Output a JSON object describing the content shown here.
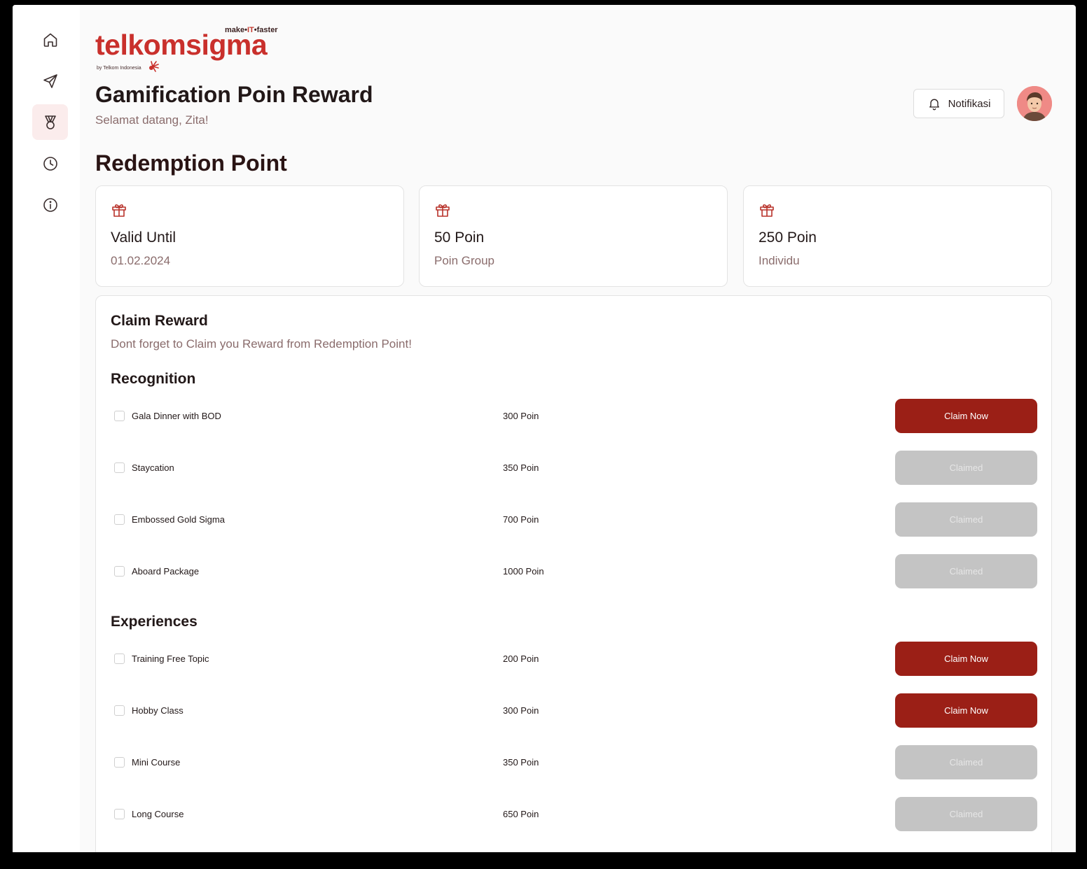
{
  "brand": {
    "tagline_pre": "make•",
    "tagline_it": "IT",
    "tagline_post": "•faster",
    "wordmark": "telkomsigma",
    "byline": "by Telkom Indonesia",
    "color": "#c9302c"
  },
  "sidebar": {
    "items": [
      {
        "icon": "home-icon",
        "active": false
      },
      {
        "icon": "send-icon",
        "active": false
      },
      {
        "icon": "medal-icon",
        "active": true
      },
      {
        "icon": "clock-icon",
        "active": false
      },
      {
        "icon": "info-icon",
        "active": false
      }
    ]
  },
  "header": {
    "title": "Gamification Poin Reward",
    "welcome": "Selamat datang, Zita!",
    "notif_label": "Notifikasi"
  },
  "redemption": {
    "title": "Redemption Point",
    "cards": [
      {
        "title": "Valid Until",
        "sub": "01.02.2024"
      },
      {
        "title": "50 Poin",
        "sub": "Poin Group"
      },
      {
        "title": "250 Poin",
        "sub": "Individu"
      }
    ]
  },
  "claim": {
    "title": "Claim Reward",
    "subtitle": "Dont forget to Claim you Reward from Redemption Point!",
    "groups": [
      {
        "title": "Recognition",
        "items": [
          {
            "name": "Gala Dinner with BOD",
            "points": "300 Poin",
            "action": "Claim Now",
            "claimed": false
          },
          {
            "name": "Staycation",
            "points": "350 Poin",
            "action": "Claimed",
            "claimed": true
          },
          {
            "name": "Embossed Gold Sigma",
            "points": "700 Poin",
            "action": "Claimed",
            "claimed": true
          },
          {
            "name": "Aboard Package",
            "points": "1000 Poin",
            "action": "Claimed",
            "claimed": true
          }
        ]
      },
      {
        "title": "Experiences",
        "items": [
          {
            "name": "Training Free Topic",
            "points": "200 Poin",
            "action": "Claim Now",
            "claimed": false
          },
          {
            "name": "Hobby Class",
            "points": "300 Poin",
            "action": "Claim Now",
            "claimed": false
          },
          {
            "name": "Mini Course",
            "points": "350 Poin",
            "action": "Claimed",
            "claimed": true
          },
          {
            "name": "Long Course",
            "points": "650 Poin",
            "action": "Claimed",
            "claimed": true
          }
        ]
      }
    ]
  },
  "colors": {
    "accent": "#9b1f16",
    "claimed": "#c4c4c4",
    "active_nav_bg": "#fbecec"
  }
}
